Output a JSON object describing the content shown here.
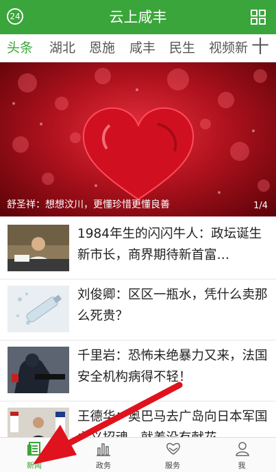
{
  "header": {
    "title": "云上咸丰",
    "badge": "24"
  },
  "tabs": [
    {
      "label": "头条",
      "active": true
    },
    {
      "label": "湖北",
      "active": false
    },
    {
      "label": "恩施",
      "active": false
    },
    {
      "label": "咸丰",
      "active": false
    },
    {
      "label": "民生",
      "active": false
    },
    {
      "label": "视频新",
      "active": false
    }
  ],
  "tabs_add": "十",
  "banner": {
    "caption": "舒圣祥：想想汶川，更懂珍惜更懂良善",
    "pager": "1/4"
  },
  "news": [
    {
      "title": "1984年生的闪闪牛人：政坛诞生新市长，商界期待新首富…"
    },
    {
      "title": "刘俊卿：区区一瓶水，凭什么卖那么死贵？"
    },
    {
      "title": "千里岩：恐怖未绝暴力又来，法国安全机构病得不轻！"
    },
    {
      "title": "王德华：奥巴马去广岛向日本军国主义招魂，就差没有献花"
    }
  ],
  "bottom_nav": [
    {
      "label": "新闻",
      "icon": "news-icon",
      "active": true
    },
    {
      "label": "政务",
      "icon": "chart-icon",
      "active": false
    },
    {
      "label": "服务",
      "icon": "heart-hands-icon",
      "active": false
    },
    {
      "label": "我",
      "icon": "person-icon",
      "active": false
    }
  ],
  "colors": {
    "brand": "#3aa53a",
    "arrow": "#e0121d"
  }
}
